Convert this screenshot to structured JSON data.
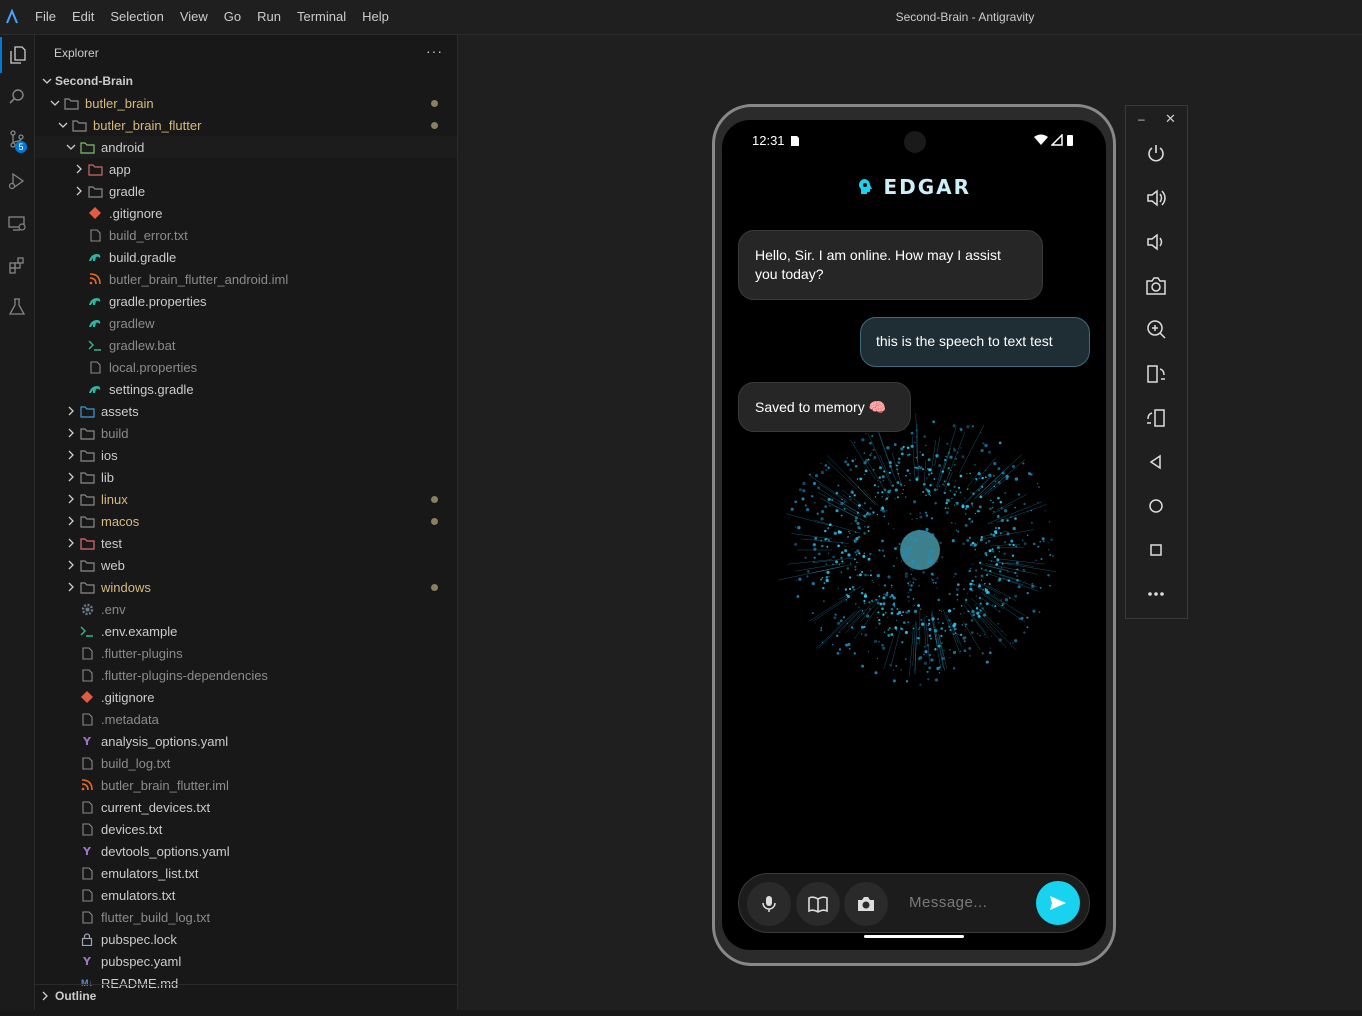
{
  "window": {
    "title": "Second-Brain - Antigravity",
    "menu": [
      "File",
      "Edit",
      "Selection",
      "View",
      "Go",
      "Run",
      "Terminal",
      "Help"
    ]
  },
  "activity_bar": {
    "items": [
      "explorer-icon",
      "search-icon",
      "source-control-icon",
      "run-debug-icon",
      "remote-explorer-icon",
      "extensions-icon",
      "testing-icon"
    ],
    "scm_badge": "5"
  },
  "explorer": {
    "title": "Explorer",
    "more": "···",
    "root": "Second-Brain",
    "outline_label": "Outline",
    "rows": [
      {
        "label": "butler_brain",
        "type": "folder",
        "open": true,
        "modified": true
      },
      {
        "label": "butler_brain_flutter",
        "type": "folder",
        "open": true,
        "modified": true
      },
      {
        "label": "android",
        "type": "folder-android",
        "open": true,
        "selected": true
      },
      {
        "label": "app",
        "type": "folder-app"
      },
      {
        "label": "gradle",
        "type": "folder"
      },
      {
        "label": ".gitignore",
        "type": "git"
      },
      {
        "label": "build_error.txt",
        "type": "file",
        "dim": true
      },
      {
        "label": "build.gradle",
        "type": "gradle"
      },
      {
        "label": "butler_brain_flutter_android.iml",
        "type": "rss",
        "dim": true
      },
      {
        "label": "gradle.properties",
        "type": "gradle"
      },
      {
        "label": "gradlew",
        "type": "gradle",
        "dim": true
      },
      {
        "label": "gradlew.bat",
        "type": "terminal",
        "dim": true
      },
      {
        "label": "local.properties",
        "type": "file",
        "dim": true
      },
      {
        "label": "settings.gradle",
        "type": "gradle"
      },
      {
        "label": "assets",
        "type": "folder-assets"
      },
      {
        "label": "build",
        "type": "folder-build",
        "dim": true
      },
      {
        "label": "ios",
        "type": "folder-ios"
      },
      {
        "label": "lib",
        "type": "folder-lib"
      },
      {
        "label": "linux",
        "type": "folder",
        "modified": true
      },
      {
        "label": "macos",
        "type": "folder",
        "modified": true
      },
      {
        "label": "test",
        "type": "folder-test"
      },
      {
        "label": "web",
        "type": "folder"
      },
      {
        "label": "windows",
        "type": "folder",
        "modified": true
      },
      {
        "label": ".env",
        "type": "gear",
        "dim": true
      },
      {
        "label": ".env.example",
        "type": "terminal"
      },
      {
        "label": ".flutter-plugins",
        "type": "file",
        "dim": true
      },
      {
        "label": ".flutter-plugins-dependencies",
        "type": "file",
        "dim": true
      },
      {
        "label": ".gitignore",
        "type": "git"
      },
      {
        "label": ".metadata",
        "type": "file",
        "dim": true
      },
      {
        "label": "analysis_options.yaml",
        "type": "yaml"
      },
      {
        "label": "build_log.txt",
        "type": "file",
        "dim": true
      },
      {
        "label": "butler_brain_flutter.iml",
        "type": "rss",
        "dim": true
      },
      {
        "label": "current_devices.txt",
        "type": "file"
      },
      {
        "label": "devices.txt",
        "type": "file"
      },
      {
        "label": "devtools_options.yaml",
        "type": "yaml"
      },
      {
        "label": "emulators_list.txt",
        "type": "file"
      },
      {
        "label": "emulators.txt",
        "type": "file"
      },
      {
        "label": "flutter_build_log.txt",
        "type": "file",
        "dim": true
      },
      {
        "label": "pubspec.lock",
        "type": "lock"
      },
      {
        "label": "pubspec.yaml",
        "type": "yaml"
      },
      {
        "label": "README.md",
        "type": "markdown"
      }
    ]
  },
  "phone": {
    "status": {
      "time": "12:31"
    },
    "app_title": "EDGAR",
    "messages": [
      {
        "from": "bot",
        "text": "Hello, Sir. I am online. How may I assist you today?"
      },
      {
        "from": "user",
        "text": "this is the speech to text test"
      },
      {
        "from": "bot",
        "text": "Saved to memory 🧠"
      }
    ],
    "input_placeholder": "Message...",
    "accent": "#18d3f0"
  },
  "emulator_toolbar": {
    "minimize": "–",
    "close": "✕",
    "buttons": [
      "power-icon",
      "volume-up-icon",
      "volume-down-icon",
      "camera-icon",
      "zoom-in-icon",
      "rotate-left-icon",
      "rotate-right-icon",
      "back-icon",
      "home-icon",
      "overview-icon",
      "more-icon"
    ]
  }
}
